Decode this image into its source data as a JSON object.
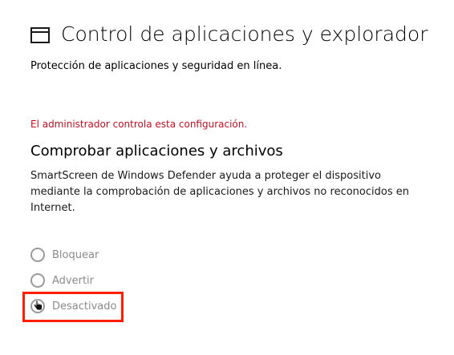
{
  "header": {
    "icon": "window-icon",
    "title": "Control de aplicaciones y explorador"
  },
  "subtitle": "Protección de aplicaciones y seguridad en línea.",
  "admin_warning": {
    "text": "El administrador controla esta configuración.",
    "color": "#c50f1f"
  },
  "section": {
    "title": "Comprobar aplicaciones y archivos",
    "description": "SmartScreen de Windows Defender ayuda a proteger el dispositivo mediante la comprobación de aplicaciones y archivos no reconocidos en Internet."
  },
  "options": [
    {
      "label": "Bloquear",
      "selected": false,
      "disabled": true
    },
    {
      "label": "Advertir",
      "selected": false,
      "disabled": true
    },
    {
      "label": "Desactivado",
      "selected": true,
      "disabled": true
    }
  ],
  "highlight_color": "#ff1e00",
  "cursor": "hand-pointer-icon"
}
